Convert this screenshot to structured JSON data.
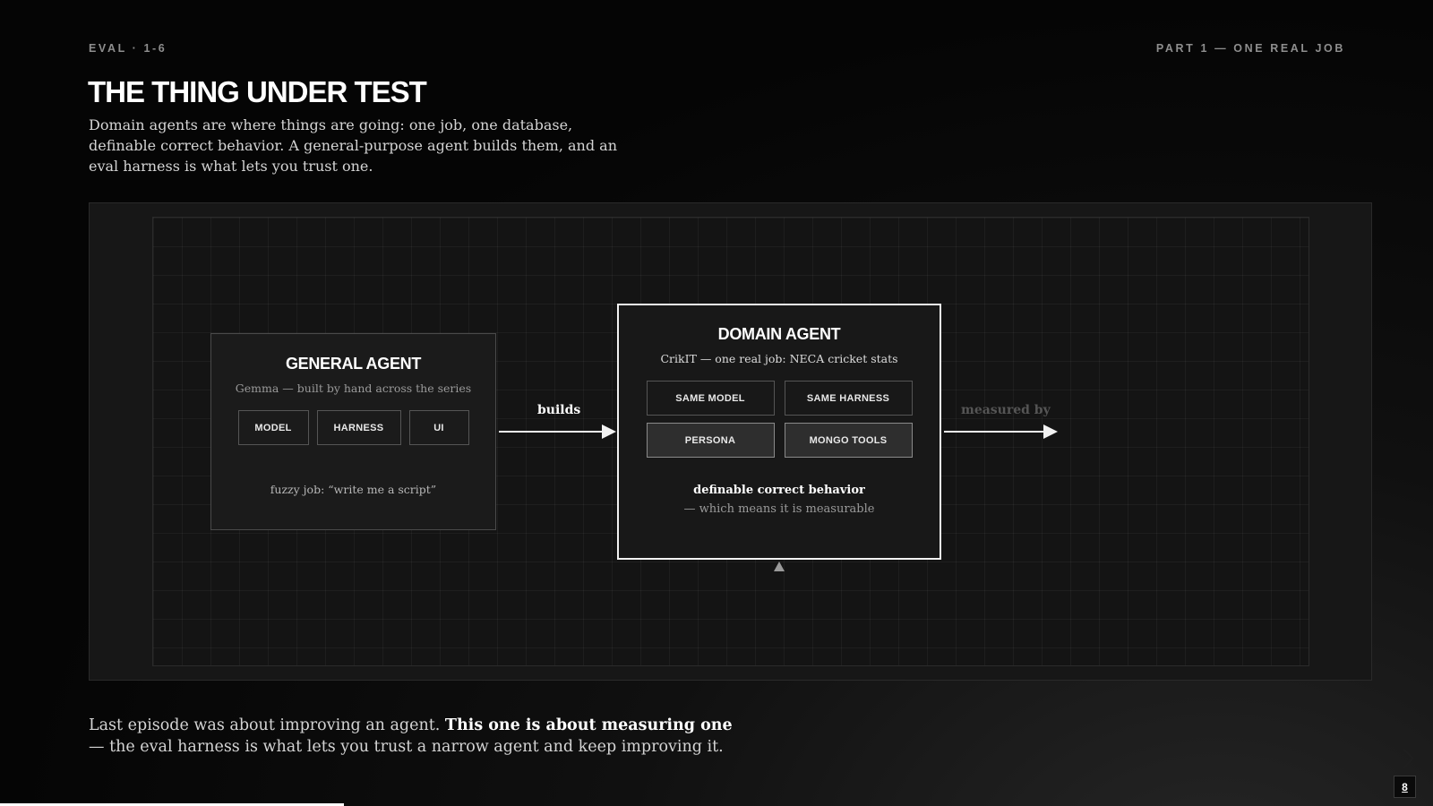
{
  "header": {
    "eyebrow_left": "EVAL · 1-6",
    "eyebrow_right": "PART 1 — ONE REAL JOB",
    "title": "THE THING UNDER TEST",
    "subtitle": "Domain agents are where things are going: one job, one database, definable correct behavior. A general-purpose agent builds them, and an eval harness is what lets you trust one."
  },
  "diagram": {
    "general_agent": {
      "title": "GENERAL AGENT",
      "subtitle": "Gemma — built by hand across the series",
      "chips": [
        "MODEL",
        "HARNESS",
        "UI"
      ],
      "footer": "fuzzy job: “write me a script”"
    },
    "builds_label": "builds",
    "domain_agent": {
      "title": "DOMAIN AGENT",
      "subtitle": "CrikIT — one real job: NECA cricket stats",
      "chips": [
        "SAME MODEL",
        "SAME HARNESS",
        "PERSONA",
        "MONGO TOOLS"
      ],
      "footer_bold": "definable correct behavior",
      "footer_sub": "— which means it is measurable"
    },
    "measured_label": "measured by"
  },
  "footer": {
    "text_before": "Last episode was about improving an agent. ",
    "text_bold": "This one is about measuring one",
    "text_after": " — the eval harness is what lets you trust a narrow agent and keep improving it."
  },
  "progress": {
    "fraction": 0.24
  },
  "page_number": "8"
}
